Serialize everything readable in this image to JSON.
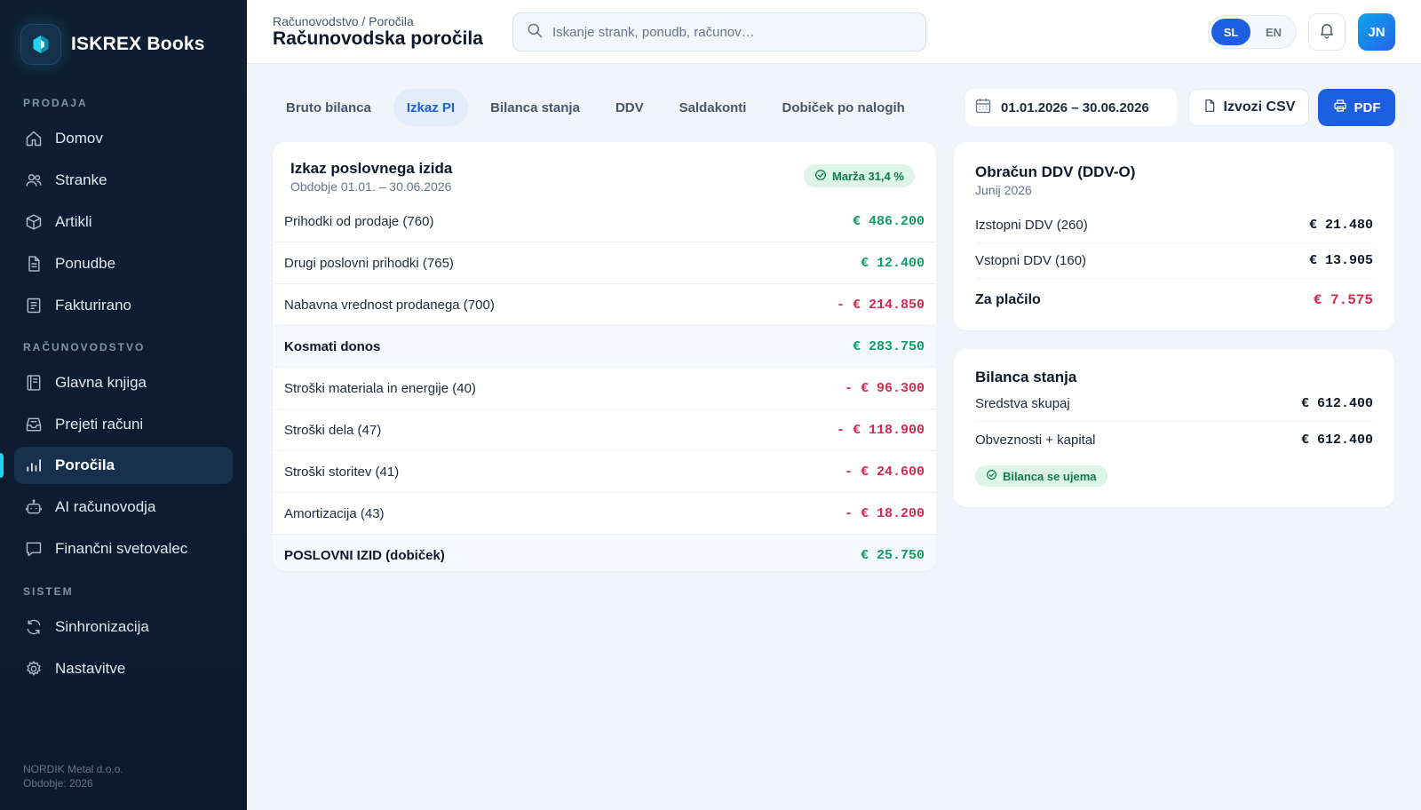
{
  "brand": {
    "name": "ISKREX Books",
    "logo_icon": "hexagon-logo-icon"
  },
  "sidebar": {
    "sections": [
      {
        "label": "PRODAJA",
        "items": [
          {
            "label": "Domov",
            "icon": "home-icon"
          },
          {
            "label": "Stranke",
            "icon": "users-icon"
          },
          {
            "label": "Artikli",
            "icon": "box-icon"
          },
          {
            "label": "Ponudbe",
            "icon": "document-icon"
          },
          {
            "label": "Fakturirano",
            "icon": "invoice-icon"
          }
        ]
      },
      {
        "label": "RAČUNOVODSTVO",
        "items": [
          {
            "label": "Glavna knjiga",
            "icon": "ledger-icon"
          },
          {
            "label": "Prejeti računi",
            "icon": "inbox-icon"
          },
          {
            "label": "Poročila",
            "icon": "bar-chart-icon",
            "active": true
          },
          {
            "label": "AI računovodja",
            "icon": "robot-icon"
          },
          {
            "label": "Finančni svetovalec",
            "icon": "chat-icon"
          }
        ]
      },
      {
        "label": "SISTEM",
        "items": [
          {
            "label": "Sinhronizacija",
            "icon": "sync-icon"
          },
          {
            "label": "Nastavitve",
            "icon": "gear-icon"
          }
        ]
      }
    ],
    "footer": {
      "company": "NORDIK Metal d.o.o.",
      "period": "Obdobje: 2026"
    }
  },
  "header": {
    "breadcrumb": "Računovodstvo / Poročila",
    "title": "Računovodska poročila",
    "search_placeholder": "Iskanje strank, ponudb, računov…",
    "languages": [
      {
        "code": "SL",
        "active": true
      },
      {
        "code": "EN",
        "active": false
      }
    ],
    "avatar_initials": "JN"
  },
  "toolbar": {
    "tabs": [
      {
        "label": "Bruto bilanca",
        "active": false
      },
      {
        "label": "Izkaz PI",
        "active": true
      },
      {
        "label": "Bilanca stanja",
        "active": false
      },
      {
        "label": "DDV",
        "active": false
      },
      {
        "label": "Saldakonti",
        "active": false
      },
      {
        "label": "Dobiček po nalogih",
        "active": false
      }
    ],
    "date_range": "01.01.2026 – 30.06.2026",
    "export_csv_label": "Izvozi CSV",
    "pdf_label": "PDF"
  },
  "income_statement": {
    "title": "Izkaz poslovnega izida",
    "subtitle": "Obdobje 01.01. – 30.06.2026",
    "margin_badge": "Marža 31,4 %",
    "rows": [
      {
        "label": "Prihodki od prodaje (760)",
        "amount": "€ 486.200",
        "tone": "pos",
        "bold": false
      },
      {
        "label": "Drugi poslovni prihodki (765)",
        "amount": "€ 12.400",
        "tone": "pos",
        "bold": false
      },
      {
        "label": "Nabavna vrednost prodanega (700)",
        "amount": "- € 214.850",
        "tone": "neg",
        "bold": false
      },
      {
        "label": "Kosmati donos",
        "amount": "€ 283.750",
        "tone": "pos",
        "bold": true
      },
      {
        "label": "Stroški materiala in energije (40)",
        "amount": "- € 96.300",
        "tone": "neg",
        "bold": false
      },
      {
        "label": "Stroški dela (47)",
        "amount": "- € 118.900",
        "tone": "neg",
        "bold": false
      },
      {
        "label": "Stroški storitev (41)",
        "amount": "- € 24.600",
        "tone": "neg",
        "bold": false
      },
      {
        "label": "Amortizacija (43)",
        "amount": "- € 18.200",
        "tone": "neg",
        "bold": false
      },
      {
        "label": "POSLOVNI IZID (dobiček)",
        "amount": "€ 25.750",
        "tone": "pos",
        "bold": true
      }
    ]
  },
  "vat": {
    "title": "Obračun DDV (DDV-O)",
    "subtitle": "Junij 2026",
    "rows": [
      {
        "label": "Izstopni DDV (260)",
        "amount": "€ 21.480"
      },
      {
        "label": "Vstopni DDV (160)",
        "amount": "€ 13.905"
      }
    ],
    "total": {
      "label": "Za plačilo",
      "amount": "€ 7.575"
    }
  },
  "balance_sheet": {
    "title": "Bilanca stanja",
    "rows": [
      {
        "label": "Sredstva skupaj",
        "amount": "€ 612.400"
      },
      {
        "label": "Obveznosti + kapital",
        "amount": "€ 612.400"
      }
    ],
    "badge": "Bilanca se ujema"
  },
  "colors": {
    "accent": "#1d5fe0",
    "positive": "#0f9d64",
    "negative": "#d6294f",
    "sidebar_bg": "#0f1e33",
    "active_marker": "#22d3ee"
  }
}
